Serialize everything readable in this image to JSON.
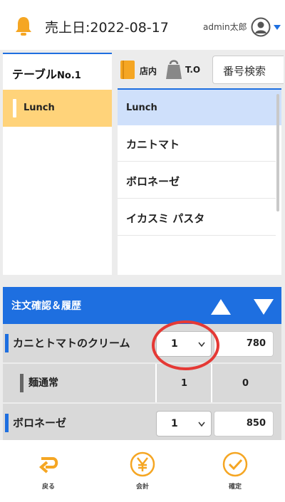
{
  "header": {
    "date_text": "売上日:2022-08-17",
    "user_name": "admin太郎"
  },
  "left_panel": {
    "table_label": "テーブル",
    "table_no": "No.1",
    "categories": [
      {
        "label": "Lunch"
      }
    ]
  },
  "top_bar": {
    "store_label": "店内",
    "takeout_label": "T.O",
    "search_label": "番号検索"
  },
  "menu": {
    "header": "Lunch",
    "items": [
      {
        "label": "カニトマト"
      },
      {
        "label": "ボロネーゼ"
      },
      {
        "label": "イカスミ パスタ"
      }
    ]
  },
  "order": {
    "title": "注文確認＆履歴",
    "rows": [
      {
        "name": "カニとトマトのクリーム",
        "qty": "1",
        "price": "780"
      },
      {
        "name": "麺通常",
        "qty": "1",
        "price": "0"
      },
      {
        "name": "ボロネーゼ",
        "qty": "1",
        "price": "850"
      }
    ]
  },
  "footer": {
    "back_label": "戻る",
    "checkout_label": "会計",
    "confirm_label": "確定"
  },
  "colors": {
    "accent_blue": "#1e6fe0",
    "accent_orange": "#f5a623",
    "selected_category": "#ffd37a",
    "highlight_red": "#e53935"
  }
}
